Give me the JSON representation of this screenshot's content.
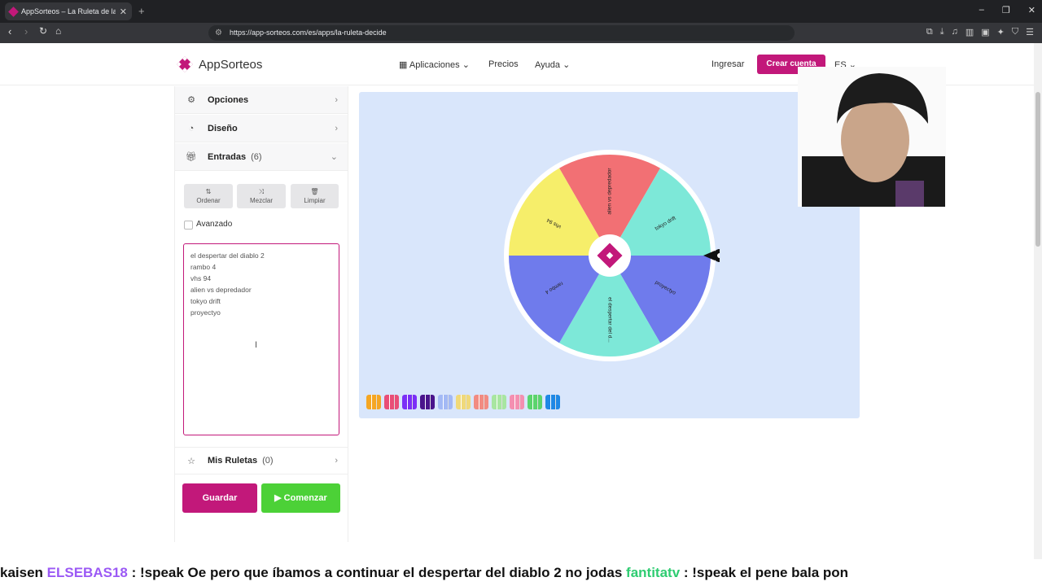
{
  "browser": {
    "tab_title": "AppSorteos – La Ruleta de la Su",
    "url": "https://app-sorteos.com/es/apps/la-ruleta-decide"
  },
  "header": {
    "brand": "AppSorteos",
    "brand_prefix": "App",
    "brand_suffix": "Sorteos",
    "nav": [
      "Aplicaciones",
      "Precios",
      "Ayuda"
    ],
    "ingresar": "Ingresar",
    "crear": "Crear cuenta",
    "lang": "ES"
  },
  "sidebar": {
    "opciones": "Opciones",
    "diseno": "Diseño",
    "entradas": "Entradas",
    "entradas_count": "(6)",
    "tools": [
      "Ordenar",
      "Mezclar",
      "Limpiar"
    ],
    "avanzado": "Avanzado",
    "entries": [
      "el despertar del diablo 2",
      "rambo 4",
      "vhs 94",
      "alien vs depredador",
      "tokyo drift",
      "proyectyo"
    ],
    "mis_ruletas": "Mis Ruletas",
    "mis_count": "(0)",
    "guardar": "Guardar",
    "comenzar": "Comenzar"
  },
  "wheel": {
    "segments": [
      {
        "label": "alien vs depredador",
        "color": "#f27074"
      },
      {
        "label": "tokyo drift",
        "color": "#7de8d8"
      },
      {
        "label": "proyectyo",
        "color": "#6f7bec"
      },
      {
        "label": "el despertar del d...",
        "color": "#7de8d8"
      },
      {
        "label": "rambo 4",
        "color": "#6f7bec"
      },
      {
        "label": "vhs 94",
        "color": "#f6ee6a"
      }
    ]
  },
  "palette": [
    "#f5a623",
    "#e94e77",
    "#7b2ff7",
    "#4a148c",
    "#a3b9f5",
    "#f0d97a",
    "#f28b82",
    "#a8e6a1",
    "#f48fb1",
    "#5bd46d",
    "#1e88e5"
  ],
  "chat": {
    "parts": [
      {
        "text": "kaisen ",
        "cls": ""
      },
      {
        "text": "ELSEBAS18",
        "cls": "nm"
      },
      {
        "text": " : !speak Oe pero que íbamos a continuar el despertar del diablo 2 ",
        "cls": ""
      },
      {
        "text": " no jodas ",
        "cls": ""
      },
      {
        "text": "fantitatv",
        "cls": "nm2"
      },
      {
        "text": " : !speak el pene bala pon",
        "cls": ""
      }
    ]
  }
}
